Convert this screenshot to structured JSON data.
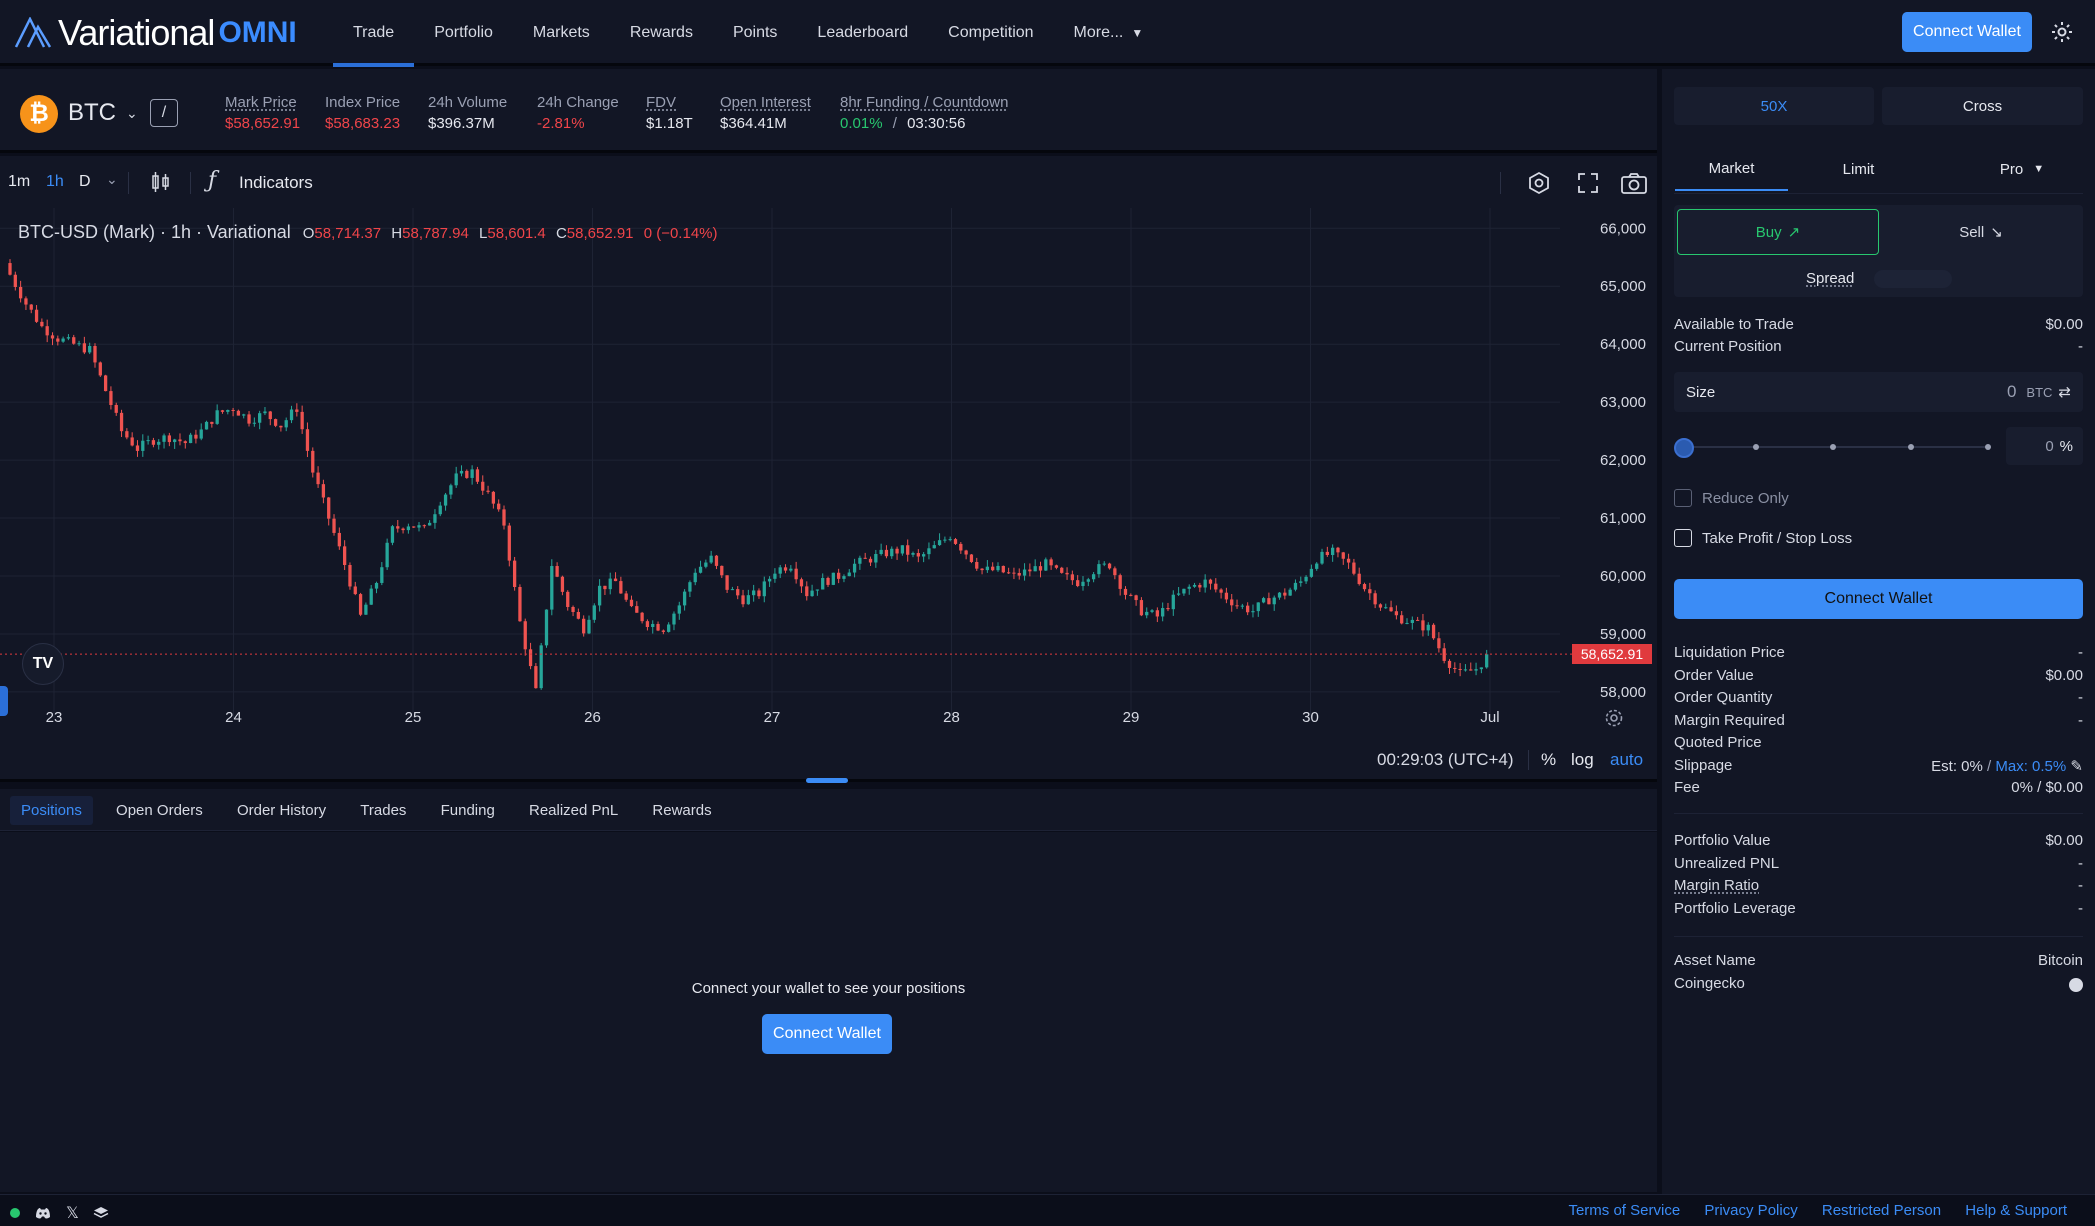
{
  "brand": {
    "name": "Variational",
    "suffix": "OMNI"
  },
  "nav": {
    "items": [
      "Trade",
      "Portfolio",
      "Markets",
      "Rewards",
      "Points",
      "Leaderboard",
      "Competition"
    ],
    "more": "More...",
    "connect": "Connect Wallet"
  },
  "ticker": {
    "symbol": "BTC",
    "coin_glyph": "₿",
    "slash": "/",
    "stats": [
      {
        "label": "Mark Price",
        "value": "$58,652.91",
        "color": "red"
      },
      {
        "label": "Index Price",
        "value": "$58,683.23",
        "color": "red"
      },
      {
        "label": "24h Volume",
        "value": "$396.37M",
        "color": ""
      },
      {
        "label": "24h Change",
        "value": "-2.81%",
        "color": "red"
      },
      {
        "label": "FDV",
        "value": "$1.18T",
        "color": ""
      },
      {
        "label": "Open Interest",
        "value": "$364.41M",
        "color": ""
      }
    ],
    "funding_label": "8hr Funding / Countdown",
    "funding_rate": "0.01%",
    "funding_sep": "/",
    "countdown": "03:30:56"
  },
  "toolbar": {
    "intervals": [
      "1m",
      "1h",
      "D"
    ],
    "active_interval": "1h",
    "indicators": "Indicators"
  },
  "chart": {
    "legend_title": "BTC-USD (Mark) · 1h · Variational",
    "ohlc": {
      "o_label": "O",
      "o": "58,714.37",
      "h_label": "H",
      "h": "58,787.94",
      "l_label": "L",
      "l": "58,601.4",
      "c_label": "C",
      "c": "58,652.91",
      "chg": "0 (−0.14%)"
    },
    "price_tag": "58,652.91",
    "time_readout": "00:29:03 (UTC+4)",
    "scale_opts": [
      "%",
      "log",
      "auto"
    ],
    "logo": "TV"
  },
  "chart_data": {
    "type": "candlestick",
    "title": "BTC-USD (Mark) · 1h · Variational",
    "y_ticks": [
      58000,
      59000,
      60000,
      61000,
      62000,
      63000,
      64000,
      65000,
      66000
    ],
    "y_tick_labels": [
      "58,000",
      "59,000",
      "60,000",
      "61,000",
      "62,000",
      "63,000",
      "64,000",
      "65,000",
      "66,000"
    ],
    "ylim": [
      57550,
      66350
    ],
    "x_tick_labels": [
      "23",
      "24",
      "25",
      "26",
      "27",
      "28",
      "29",
      "30",
      "Jul"
    ],
    "colors": {
      "up": "#26a69a",
      "down": "#ef5350"
    },
    "last_price": 58652.91,
    "close_path": [
      65200,
      64700,
      64300,
      64100,
      64000,
      63900,
      63200,
      62500,
      62200,
      62350,
      62400,
      62300,
      62500,
      62800,
      62900,
      62700,
      62800,
      62600,
      62900,
      61800,
      61000,
      60200,
      59300,
      59900,
      60800,
      60900,
      60800,
      61300,
      61700,
      61800,
      61400,
      60900,
      59200,
      58000,
      60200,
      59500,
      59100,
      59800,
      59900,
      59400,
      59200,
      59100,
      59500,
      60100,
      60300,
      59800,
      59600,
      59700,
      60100,
      60200,
      59700,
      59900,
      60000,
      60200,
      60300,
      60400,
      60450,
      60300,
      60500,
      60700,
      60400,
      60100,
      60100,
      60000,
      60100,
      60200,
      60000,
      59900,
      60100,
      60200,
      59700,
      59400,
      59300,
      59600,
      59800,
      59900,
      59700,
      59500,
      59400,
      59600,
      59700,
      59900,
      60300,
      60400,
      60200,
      59800,
      59500,
      59300,
      59200,
      59100,
      58600,
      58300,
      58400,
      58700
    ]
  },
  "tabs": [
    "Positions",
    "Open Orders",
    "Order History",
    "Trades",
    "Funding",
    "Realized PnL",
    "Rewards"
  ],
  "positions": {
    "empty": "Connect your wallet to see your positions",
    "connect": "Connect Wallet"
  },
  "order": {
    "leverage": "50X",
    "margin_mode": "Cross",
    "types": [
      "Market",
      "Limit"
    ],
    "pro": "Pro",
    "buy": "Buy",
    "sell": "Sell",
    "spread": "Spread",
    "available_label": "Available to Trade",
    "available_value": "$0.00",
    "position_label": "Current Position",
    "position_value": "-",
    "size_label": "Size",
    "size_value": "0",
    "size_unit": "BTC",
    "slider_pct": 0,
    "pct_value": "0",
    "pct_unit": "%",
    "reduce_only": "Reduce Only",
    "tpsl": "Take Profit / Stop Loss",
    "connect": "Connect Wallet"
  },
  "summary": [
    {
      "label": "Liquidation Price",
      "value": "-"
    },
    {
      "label": "Order Value",
      "value": "$0.00"
    },
    {
      "label": "Order Quantity",
      "value": "-"
    },
    {
      "label": "Margin Required",
      "value": "-"
    },
    {
      "label": "Quoted Price",
      "value": ""
    },
    {
      "label": "Slippage",
      "value": ""
    },
    {
      "label": "Fee",
      "value": "0% / $0.00"
    }
  ],
  "slippage": {
    "est": "Est: 0%",
    "sep": "/",
    "max": "Max: 0.5%"
  },
  "portfolio": [
    {
      "label": "Portfolio Value",
      "value": "$0.00"
    },
    {
      "label": "Unrealized PNL",
      "value": "-"
    },
    {
      "label": "Margin Ratio",
      "value": "-"
    },
    {
      "label": "Portfolio Leverage",
      "value": "-"
    }
  ],
  "asset": [
    {
      "label": "Asset Name",
      "value": "Bitcoin"
    },
    {
      "label": "Coingecko",
      "value": ""
    }
  ],
  "footer": {
    "links": [
      "Terms of Service",
      "Privacy Policy",
      "Restricted Person",
      "Help & Support"
    ]
  }
}
